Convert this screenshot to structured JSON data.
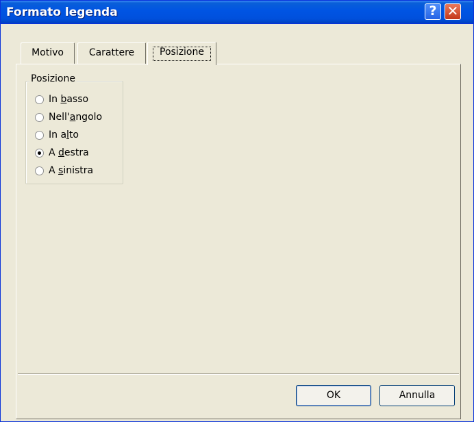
{
  "window": {
    "title": "Formato legenda"
  },
  "title_buttons": {
    "help": "?",
    "close": "✕"
  },
  "tabs": [
    {
      "label": "Motivo"
    },
    {
      "label": "Carattere"
    },
    {
      "label": "Posizione",
      "selected": true
    }
  ],
  "position_group": {
    "label": "Posizione",
    "options": [
      {
        "pre": "In ",
        "accel": "b",
        "post": "asso",
        "checked": false
      },
      {
        "pre": "Nell'",
        "accel": "a",
        "post": "ngolo",
        "checked": false
      },
      {
        "pre": "In a",
        "accel": "l",
        "post": "to",
        "checked": false
      },
      {
        "pre": "A ",
        "accel": "d",
        "post": "estra",
        "checked": true
      },
      {
        "pre": "A ",
        "accel": "s",
        "post": "inistra",
        "checked": false
      }
    ]
  },
  "buttons": {
    "ok": "OK",
    "cancel": "Annulla"
  }
}
